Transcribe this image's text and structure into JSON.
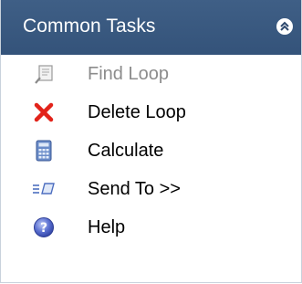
{
  "panel": {
    "title": "Common Tasks",
    "collapse_icon": "double-chevron-up-icon"
  },
  "tasks": [
    {
      "label": "Find Loop",
      "icon": "find-loop-icon",
      "enabled": false
    },
    {
      "label": "Delete Loop",
      "icon": "delete-x-icon",
      "enabled": true
    },
    {
      "label": "Calculate",
      "icon": "calculator-icon",
      "enabled": true
    },
    {
      "label": "Send To >>",
      "icon": "send-to-icon",
      "enabled": true
    },
    {
      "label": "Help",
      "icon": "help-icon",
      "enabled": true
    }
  ],
  "colors": {
    "header_bg": "#3a5a80",
    "header_text": "#ffffff",
    "delete_red": "#e2231a",
    "help_blue": "#5a6fd0",
    "calc_blue": "#4f6fb4",
    "disabled_text": "#8c8c8c"
  }
}
